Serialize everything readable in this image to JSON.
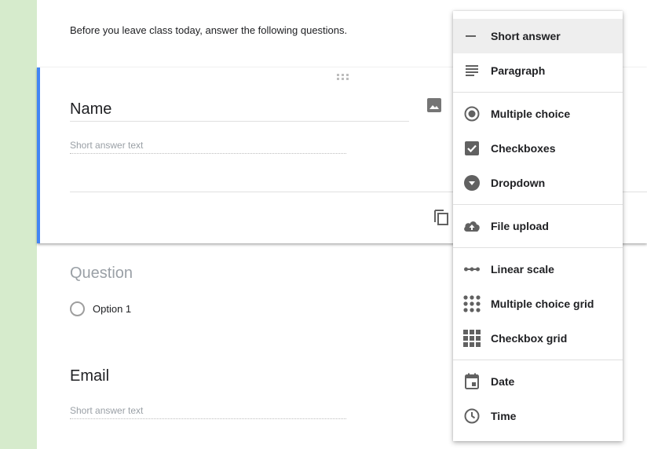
{
  "form": {
    "description": "Before you leave class today, answer the following questions.",
    "active_question": {
      "title": "Name",
      "answer_hint": "Short answer text"
    },
    "question2": {
      "title_placeholder": "Question",
      "option1": "Option 1"
    },
    "question3": {
      "title": "Email",
      "answer_hint": "Short answer text"
    }
  },
  "type_menu": {
    "selected": "Short answer",
    "groups": [
      [
        {
          "label": "Short answer",
          "icon": "short-answer-icon"
        },
        {
          "label": "Paragraph",
          "icon": "paragraph-icon"
        }
      ],
      [
        {
          "label": "Multiple choice",
          "icon": "radio-icon"
        },
        {
          "label": "Checkboxes",
          "icon": "checkbox-icon"
        },
        {
          "label": "Dropdown",
          "icon": "dropdown-icon"
        }
      ],
      [
        {
          "label": "File upload",
          "icon": "cloud-upload-icon"
        }
      ],
      [
        {
          "label": "Linear scale",
          "icon": "linear-scale-icon"
        },
        {
          "label": "Multiple choice grid",
          "icon": "dot-grid-icon"
        },
        {
          "label": "Checkbox grid",
          "icon": "square-grid-icon"
        }
      ],
      [
        {
          "label": "Date",
          "icon": "calendar-icon"
        },
        {
          "label": "Time",
          "icon": "clock-icon"
        }
      ]
    ]
  },
  "colors": {
    "accent": "#4285f4",
    "background": "#d6ebcc",
    "icon": "#616161"
  }
}
